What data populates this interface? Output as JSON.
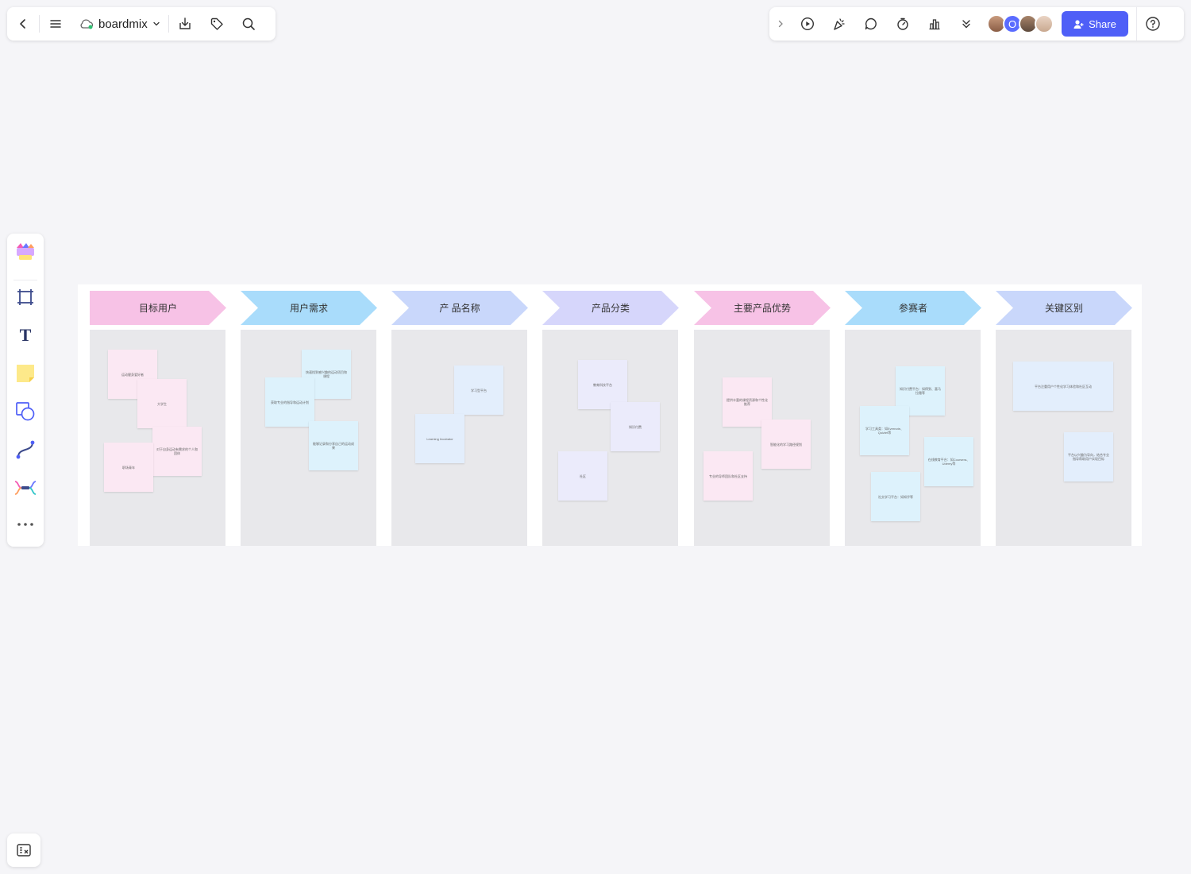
{
  "app": {
    "name": "boardmix"
  },
  "toolbar_left": {
    "back_icon": "chevron-left-icon",
    "menu_icon": "hamburger-menu-icon",
    "cloud_icon": "cloud-sync-icon",
    "dropdown_icon": "chevron-down-icon",
    "download_icon": "download-icon",
    "tag_icon": "tag-icon",
    "search_icon": "search-icon"
  },
  "toolbar_right": {
    "share_label": "Share",
    "avatar_letter": "O",
    "icons": [
      "chevron-right-icon",
      "play-icon",
      "celebrate-icon",
      "comment-icon",
      "timer-icon",
      "vote-icon",
      "more-down-icon",
      "help-icon"
    ]
  },
  "left_toolbar": {
    "tools": [
      "template-icon",
      "frame-icon",
      "text-icon",
      "sticky-note-icon",
      "shape-icon",
      "connector-icon",
      "mindmap-icon",
      "more-icon"
    ],
    "text_tool_glyph": "T"
  },
  "colors": {
    "accent": "#4f5ff7",
    "pink_header": "#f7c2e6",
    "blue_header": "#a9dcfb",
    "periwinkle_header": "#c9d7fb",
    "lavender_header": "#d6d6fb",
    "pink_note": "#fbe8f3",
    "blue_note": "#ddf2fc",
    "periwinkle_note": "#e3eefc",
    "lavender_note": "#ebebfb"
  },
  "board": {
    "columns": [
      {
        "title": "目标用户",
        "notes": [
          "运动健身爱好者",
          "大学生",
          "对于自身运动有需求的个人和团体",
          "职场青年"
        ]
      },
      {
        "title": "用户需求",
        "notes": [
          "快速找到感兴趣的运动项目和课程",
          "获取专业的指导和运动计划",
          "能够记录和分享自己的运动成果"
        ]
      },
      {
        "title": "产 品名称",
        "notes": [
          "学习型平台",
          "Learning Incubator"
        ]
      },
      {
        "title": "产品分类",
        "notes": [
          "教育科技平台",
          "知识付费",
          "社区"
        ]
      },
      {
        "title": "主要产品优势",
        "notes": [
          "提供丰富的课程资源和个性化推荐",
          "智能化的学习路径规划",
          "专业的导师团队和社区支持"
        ]
      },
      {
        "title": "参赛者",
        "notes": [
          "知识付费平台：如得到、喜马拉雅等",
          "学习工具类：如Evernote、Quizlet等",
          "在线教育平台：如Coursera、Udemy等",
          "社交学习平台：如知乎等"
        ]
      },
      {
        "title": "关键区别",
        "notes": [
          "平台注重用户个性化学习体验和社区互动",
          "平台以兴趣为导向，结合专业指导帮助用户实现目标"
        ]
      }
    ]
  }
}
